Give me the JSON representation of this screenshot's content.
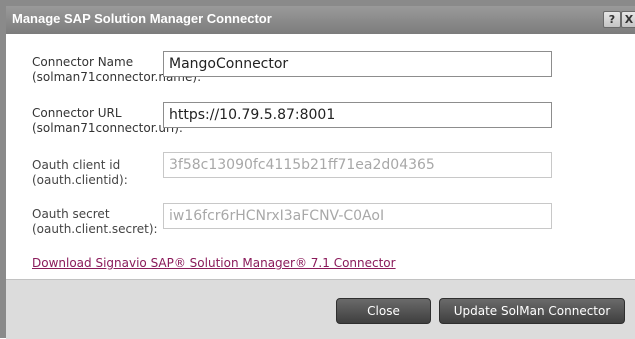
{
  "dialog": {
    "title": "Manage SAP Solution Manager Connector",
    "help_label": "?",
    "close_label": "X"
  },
  "fields": [
    {
      "label": "Connector Name",
      "sublabel": "(solman71connector.name):",
      "value": "MangoConnector",
      "disabled": false
    },
    {
      "label": "Connector URL",
      "sublabel": "(solman71connector.url):",
      "value": "https://10.79.5.87:8001",
      "disabled": false
    },
    {
      "label": "Oauth client id",
      "sublabel": "(oauth.clientid):",
      "value": "3f58c13090fc4115b21ff71ea2d04365",
      "disabled": true
    },
    {
      "label": "Oauth secret",
      "sublabel": "(oauth.client.secret):",
      "value": "iw16fcr6rHCNrxI3aFCNV-C0AoI",
      "disabled": true
    }
  ],
  "download_link": "Download Signavio SAP® Solution Manager® 7.1 Connector",
  "buttons": {
    "close": "Close",
    "update": "Update SolMan Connector"
  },
  "colors": {
    "titlebar": "#8a8a8a",
    "link": "#8a1a5a",
    "button": "#4f4f4f",
    "footer": "#dcdcdc"
  }
}
